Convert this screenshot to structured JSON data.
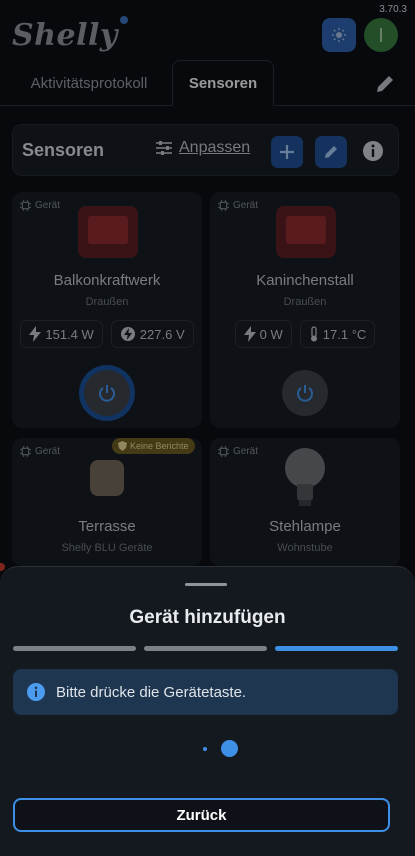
{
  "app": {
    "version": "3.70.3",
    "logo_text": "Shelly",
    "accent": "#3e8fe6"
  },
  "tabs": [
    {
      "label": "Aktivitätsprotokoll",
      "active": false
    },
    {
      "label": "Sensoren",
      "active": true
    }
  ],
  "sensor_bar": {
    "title": "Sensoren",
    "adjust_label": "Anpassen"
  },
  "devices": [
    {
      "badge": "Gerät",
      "name": "Balkonkraftwerk",
      "room": "Draußen",
      "stats": [
        "151.4 W",
        "227.6 V"
      ],
      "power_state": "on"
    },
    {
      "badge": "Gerät",
      "name": "Kaninchenstall",
      "room": "Draußen",
      "stats": [
        "0 W",
        "17.1 °C"
      ],
      "power_state": "off"
    },
    {
      "badge": "Gerät",
      "name": "Terrasse",
      "room": "Shelly BLU Geräte",
      "warning": "Keine Berichte"
    },
    {
      "badge": "Gerät",
      "name": "Stehlampe",
      "room": "Wohnstube"
    }
  ],
  "sheet": {
    "title": "Gerät hinzufügen",
    "steps_total": 3,
    "current_step": 3,
    "info_message": "Bitte drücke die Gerätetaste.",
    "back_label": "Zurück"
  }
}
